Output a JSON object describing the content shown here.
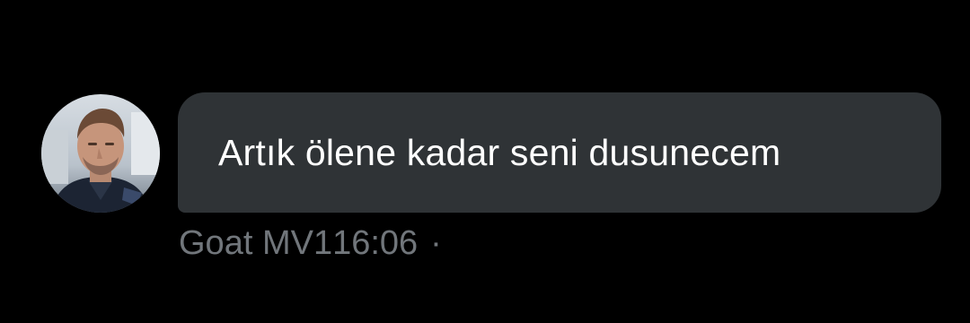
{
  "message": {
    "text": "Artık ölene kadar seni dusunecem",
    "sender": "Goat MV1",
    "time": "16:06",
    "separator": "·"
  },
  "colors": {
    "background": "#000000",
    "bubble": "#2f3336",
    "message_text": "#ffffff",
    "meta_text": "#71767b"
  },
  "icons": {
    "avatar": "user-avatar-photo"
  }
}
